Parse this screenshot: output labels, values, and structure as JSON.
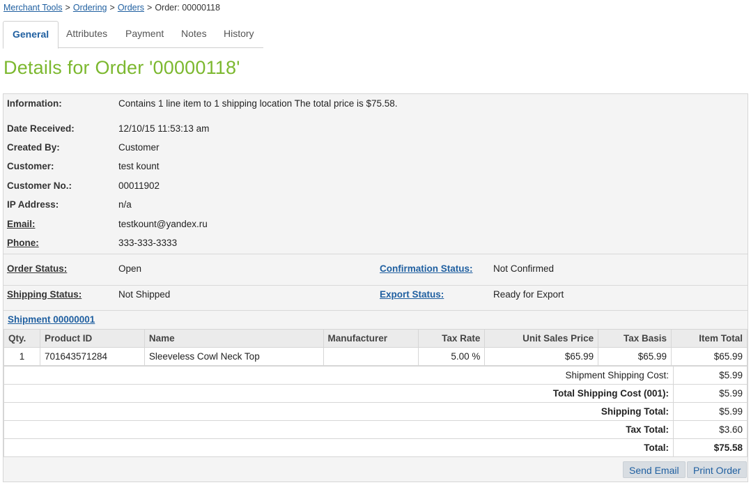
{
  "breadcrumb": {
    "items": [
      "Merchant Tools",
      "Ordering",
      "Orders"
    ],
    "current": "Order: 00000118",
    "separator": ">"
  },
  "tabs": [
    "General",
    "Attributes",
    "Payment",
    "Notes",
    "History"
  ],
  "page_title": "Details for Order '00000118'",
  "info": {
    "information_label": "Information:",
    "information_value": "Contains 1 line item to 1 shipping location The total price is $75.58.",
    "date_label": "Date Received:",
    "date_value": "12/10/15 11:53:13 am",
    "created_label": "Created By:",
    "created_value": "Customer",
    "customer_label": "Customer:",
    "customer_value": "test kount",
    "customer_no_label": "Customer No.:",
    "customer_no_value": "00011902",
    "ip_label": "IP Address:",
    "ip_value": "n/a",
    "email_label": "Email:",
    "email_value": "testkount@yandex.ru",
    "phone_label": "Phone:",
    "phone_value": "333-333-3333"
  },
  "status": {
    "order_status_label": "Order Status:",
    "order_status_value": "Open",
    "confirmation_label": "Confirmation Status:",
    "confirmation_value": "Not Confirmed",
    "shipping_status_label": "Shipping Status:",
    "shipping_status_value": "Not Shipped",
    "export_label": "Export Status:",
    "export_value": "Ready for Export"
  },
  "shipment": {
    "title": "Shipment 00000001",
    "columns": [
      "Qty.",
      "Product ID",
      "Name",
      "Manufacturer",
      "Tax Rate",
      "Unit Sales Price",
      "Tax Basis",
      "Item Total"
    ],
    "rows": [
      [
        "1",
        "701643571284",
        "Sleeveless Cowl Neck Top",
        "",
        "5.00 %",
        "$65.99",
        "$65.99",
        "$65.99"
      ]
    ]
  },
  "totals": [
    {
      "label": "Shipment Shipping Cost:",
      "value": "$5.99"
    },
    {
      "label": "Total Shipping Cost (001):",
      "value": "$5.99"
    },
    {
      "label": "Shipping Total:",
      "value": "$5.99"
    },
    {
      "label": "Tax Total:",
      "value": "$3.60"
    },
    {
      "label": "Total:",
      "value": "$75.58"
    }
  ],
  "buttons": {
    "send_email": "Send Email",
    "print_order": "Print Order"
  }
}
